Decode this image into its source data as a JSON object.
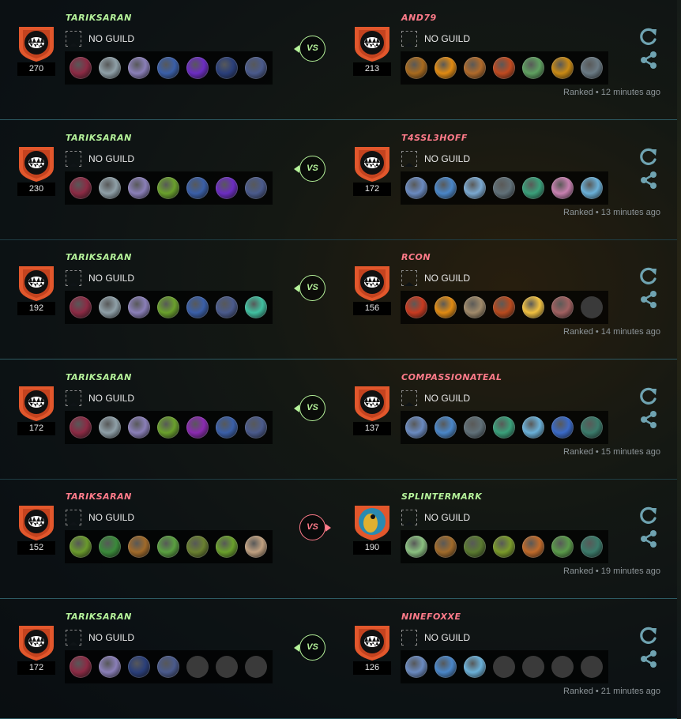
{
  "colors": {
    "win": "#b5f29a",
    "lose": "#ff7b8a",
    "divider": "#2d5a63",
    "action_icon": "#6fa3b1",
    "avatar_orange": "#e2572c"
  },
  "icons": {
    "avatar": "fanged-mouth-icon",
    "guild": "guild-banner-icon",
    "replay": "replay-icon",
    "share": "share-icon"
  },
  "battles": [
    {
      "left": {
        "name": "TARIKSARAN",
        "result": "win",
        "rating": "270",
        "guild": "NO GUILD",
        "avatar": "orange-fang",
        "cards": [
          "#8b2a44",
          "#8fa0a8",
          "#8a7fb8",
          "#3a5fa8",
          "#6c2cc2",
          "#2a3f7a",
          "#4a5a8c"
        ]
      },
      "right": {
        "name": "AND79",
        "result": "lose",
        "rating": "213",
        "guild": "NO GUILD",
        "avatar": "orange-fang",
        "cards": [
          "#a86a1e",
          "#e08a12",
          "#b06a2a",
          "#c04a20",
          "#5fa060",
          "#c98a14",
          "#6a7a84"
        ]
      },
      "ranked": "Ranked",
      "time": "12 minutes ago"
    },
    {
      "left": {
        "name": "TARIKSARAN",
        "result": "win",
        "rating": "230",
        "guild": "NO GUILD",
        "avatar": "orange-fang",
        "cards": [
          "#8b2a44",
          "#8fa0a8",
          "#8a7fb8",
          "#6aa02c",
          "#3a5fa8",
          "#6c2cc2",
          "#4a5a8c"
        ]
      },
      "right": {
        "name": "T4SSL3HOFF",
        "result": "lose",
        "rating": "172",
        "guild": "NO GUILD",
        "avatar": "orange-fang",
        "cards": [
          "#6a8ac0",
          "#4a86c8",
          "#7aa8d0",
          "#607078",
          "#3aa07a",
          "#c880b0",
          "#6ab0d8"
        ]
      },
      "ranked": "Ranked",
      "time": "13 minutes ago"
    },
    {
      "left": {
        "name": "TARIKSARAN",
        "result": "win",
        "rating": "192",
        "guild": "NO GUILD",
        "avatar": "orange-fang",
        "cards": [
          "#8b2a44",
          "#8fa0a8",
          "#8a7fb8",
          "#6aa02c",
          "#3a5fa8",
          "#4a5a8c",
          "#40c0a0"
        ]
      },
      "right": {
        "name": "RCON",
        "result": "lose",
        "rating": "156",
        "guild": "NO GUILD",
        "avatar": "orange-fang",
        "cards": [
          "#c83a20",
          "#e08a12",
          "#a08a6a",
          "#b84a1e",
          "#f0c040",
          "#a06060",
          "empty"
        ]
      },
      "ranked": "Ranked",
      "time": "14 minutes ago"
    },
    {
      "left": {
        "name": "TARIKSARAN",
        "result": "win",
        "rating": "172",
        "guild": "NO GUILD",
        "avatar": "orange-fang",
        "cards": [
          "#8b2a44",
          "#8fa0a8",
          "#8a7fb8",
          "#6aa02c",
          "#8a2ab0",
          "#3a5fa8",
          "#4a5a8c"
        ]
      },
      "right": {
        "name": "COMPASSIONATEAL",
        "result": "lose",
        "rating": "137",
        "guild": "NO GUILD",
        "avatar": "orange-fang",
        "cards": [
          "#6a8ac0",
          "#4a86c8",
          "#607078",
          "#3aa07a",
          "#6ab0d8",
          "#3a6ac8",
          "#3a7a6a"
        ]
      },
      "ranked": "Ranked",
      "time": "15 minutes ago"
    },
    {
      "left": {
        "name": "TARIKSARAN",
        "result": "lose",
        "rating": "152",
        "guild": "NO GUILD",
        "avatar": "orange-fang",
        "cards": [
          "#6a9a2c",
          "#3a8a3a",
          "#a06a2a",
          "#5aa040",
          "#6a8030",
          "#6aa02c",
          "#c0a080"
        ]
      },
      "right": {
        "name": "SPLINTERMARK",
        "result": "win",
        "rating": "190",
        "guild": "NO GUILD",
        "avatar": "dragon",
        "cards": [
          "#8ac080",
          "#a06a2a",
          "#5a7a30",
          "#7a9a2a",
          "#c06a2a",
          "#5a9a4a",
          "#3a7a6a"
        ]
      },
      "ranked": "Ranked",
      "time": "19 minutes ago"
    },
    {
      "left": {
        "name": "TARIKSARAN",
        "result": "win",
        "rating": "172",
        "guild": "NO GUILD",
        "avatar": "orange-fang",
        "cards": [
          "#8b2a44",
          "#8a7fb8",
          "#2a3f7a",
          "#4a5a8c",
          "empty",
          "empty",
          "empty"
        ]
      },
      "right": {
        "name": "NINEFOXXE",
        "result": "lose",
        "rating": "126",
        "guild": "NO GUILD",
        "avatar": "orange-fang",
        "cards": [
          "#6a8ac0",
          "#4a86c8",
          "#6ab0d8",
          "empty",
          "empty",
          "empty",
          "empty"
        ]
      },
      "ranked": "Ranked",
      "time": "21 minutes ago"
    }
  ]
}
